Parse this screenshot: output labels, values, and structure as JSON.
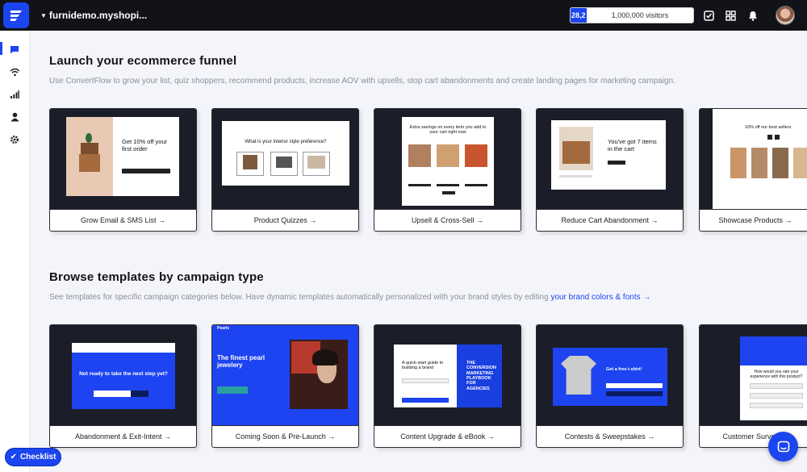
{
  "header": {
    "store_name": "furnidemo.myshopi...",
    "visitors_used": "28,2",
    "visitors_limit": "1,000,000 visitors",
    "visitors_progress": 0.028
  },
  "sections": {
    "funnel": {
      "title": "Launch your ecommerce funnel",
      "subtitle": "Use ConvertFlow to grow your list, quiz shoppers, recommend products, increase AOV with upsells, stop cart abandonments and create landing pages for marketing campaign."
    },
    "templates": {
      "title": "Browse templates by campaign type",
      "subtitle": "See templates for specific campaign categories below. Have dynamic templates automatically personalized with your brand styles by editing ",
      "link": "your brand colors & fonts →"
    }
  },
  "funnel_cards": [
    {
      "label": "Grow Email & SMS List →"
    },
    {
      "label": "Product Quizzes →"
    },
    {
      "label": "Upsell & Cross-Sell →"
    },
    {
      "label": "Reduce Cart Abandonment →"
    },
    {
      "label": "Showcase Products →"
    }
  ],
  "template_cards": [
    {
      "label": "Abandonment & Exit-Intent →"
    },
    {
      "label": "Coming Soon & Pre-Launch →"
    },
    {
      "label": "Content Upgrade & eBook →"
    },
    {
      "label": "Contests & Sweepstakes →"
    },
    {
      "label": "Customer Survey →"
    }
  ],
  "previews": {
    "email": {
      "heading": "Get 10% off your first order"
    },
    "quiz": {
      "question": "What is your interior style preference?"
    },
    "upsell": {
      "heading": "Extra savings on every item you add to your cart right now"
    },
    "cart": {
      "heading": "You've got 7 items in the cart"
    },
    "showcase": {
      "heading": "10% off our best sellers"
    },
    "exit": {
      "heading": "Not ready to take the next step yet?"
    },
    "coming": {
      "brand": "Pearls",
      "heading": "The finest pearl jewelery"
    },
    "ebook": {
      "heading": "A quick-start guide to building a brand",
      "cover": "THE CONVERSION MARKETING PLAYBOOK FOR AGENCIES"
    },
    "contest": {
      "heading": "Get a free t-shirt!"
    },
    "survey": {
      "heading": "How would you rate your experience with this product?"
    }
  },
  "footer": {
    "checklist_label": "Checklist"
  },
  "colors": {
    "brand_blue": "#1b45ee",
    "topbar": "#111319"
  }
}
